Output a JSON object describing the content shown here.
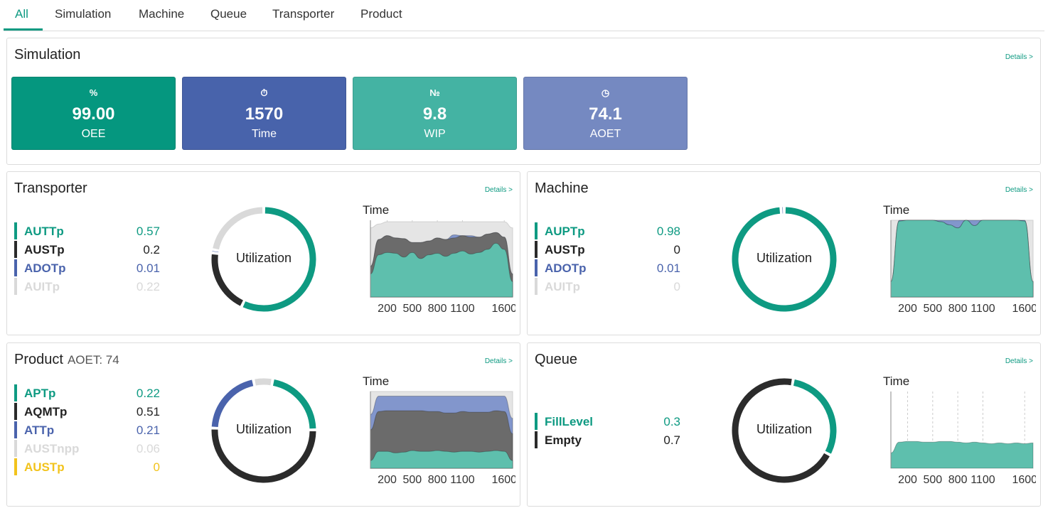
{
  "colors": {
    "teal": "#0e9a82",
    "dark": "#2b2b2b",
    "blue": "#4a63ac",
    "light": "#d9d9d9",
    "yellow": "#f2c31c",
    "area_teal": "#5ebfad",
    "area_dark": "#6b6b6b",
    "area_blue": "#8296cc",
    "area_light": "#e5e5e5"
  },
  "tabs": [
    {
      "label": "All",
      "active": true
    },
    {
      "label": "Simulation"
    },
    {
      "label": "Machine"
    },
    {
      "label": "Queue"
    },
    {
      "label": "Transporter"
    },
    {
      "label": "Product"
    }
  ],
  "simulation": {
    "title": "Simulation",
    "details": "Details >",
    "kpis": [
      {
        "icon": "percent-icon",
        "glyph": "%",
        "value": "99.00",
        "label": "OEE",
        "color": "#05977f"
      },
      {
        "icon": "stopwatch-icon",
        "glyph": "⏱",
        "value": "1570",
        "label": "Time",
        "color": "#4863ab"
      },
      {
        "icon": "numero-icon",
        "glyph": "№",
        "value": "9.8",
        "label": "WIP",
        "color": "#44b3a3"
      },
      {
        "icon": "clock-icon",
        "glyph": "◷",
        "value": "74.1",
        "label": "AOET",
        "color": "#7589c1"
      }
    ]
  },
  "transporter": {
    "title": "Transporter",
    "details": "Details >",
    "donut_label": "Utilization",
    "chart_title": "Time",
    "legend": [
      {
        "name": "AUTTp",
        "value": "0.57",
        "color": "#0e9a82"
      },
      {
        "name": "AUSTp",
        "value": "0.2",
        "color": "#2b2b2b"
      },
      {
        "name": "ADOTp",
        "value": "0.01",
        "color": "#4a63ac"
      },
      {
        "name": "AUITp",
        "value": "0.22",
        "color": "#d9d9d9"
      }
    ]
  },
  "machine": {
    "title": "Machine",
    "details": "Details >",
    "donut_label": "Utilization",
    "chart_title": "Time",
    "legend": [
      {
        "name": "AUPTp",
        "value": "0.98",
        "color": "#0e9a82"
      },
      {
        "name": "AUSTp",
        "value": "0",
        "color": "#2b2b2b"
      },
      {
        "name": "ADOTp",
        "value": "0.01",
        "color": "#4a63ac"
      },
      {
        "name": "AUITp",
        "value": "0",
        "color": "#d9d9d9"
      }
    ]
  },
  "product": {
    "title": "Product",
    "subtitle": "AOET: 74",
    "details": "Details >",
    "donut_label": "Utilization",
    "chart_title": "Time",
    "legend": [
      {
        "name": "APTp",
        "value": "0.22",
        "color": "#0e9a82"
      },
      {
        "name": "AQMTp",
        "value": "0.51",
        "color": "#2b2b2b"
      },
      {
        "name": "ATTp",
        "value": "0.21",
        "color": "#4a63ac"
      },
      {
        "name": "AUSTnpp",
        "value": "0.06",
        "color": "#d9d9d9"
      },
      {
        "name": "AUSTp",
        "value": "0",
        "color": "#f2c31c"
      }
    ]
  },
  "queue": {
    "title": "Queue",
    "details": "Details >",
    "donut_label": "Utilization",
    "chart_title": "Time",
    "legend": [
      {
        "name": "FillLevel",
        "value": "0.3",
        "color": "#0e9a82"
      },
      {
        "name": "Empty",
        "value": "0.7",
        "color": "#2b2b2b"
      }
    ]
  },
  "chart_data": [
    {
      "id": "transporter",
      "type": "area",
      "title": "Time",
      "x_ticks": [
        "200",
        "500",
        "800",
        "1100",
        "1600"
      ],
      "x": [
        0,
        100,
        200,
        300,
        400,
        500,
        600,
        700,
        800,
        900,
        1000,
        1100,
        1200,
        1300,
        1400,
        1500,
        1600,
        1700
      ],
      "ylim": [
        0,
        1
      ],
      "stacked": true,
      "series": [
        {
          "name": "AUTTp",
          "color": "#5ebfad",
          "values": [
            0.3,
            0.55,
            0.58,
            0.57,
            0.52,
            0.58,
            0.5,
            0.55,
            0.57,
            0.53,
            0.57,
            0.6,
            0.56,
            0.58,
            0.62,
            0.7,
            0.62,
            0.2
          ]
        },
        {
          "name": "AUSTp",
          "color": "#6b6b6b",
          "values": [
            0.1,
            0.2,
            0.22,
            0.2,
            0.24,
            0.13,
            0.21,
            0.18,
            0.2,
            0.22,
            0.2,
            0.2,
            0.22,
            0.2,
            0.2,
            0.14,
            0.16,
            0.1
          ]
        },
        {
          "name": "ADOTp",
          "color": "#8296cc",
          "values": [
            0,
            0,
            0,
            0,
            0,
            0,
            0,
            0,
            0,
            0,
            0.04,
            0,
            0.02,
            0,
            0,
            0,
            0,
            0
          ]
        },
        {
          "name": "AUITp",
          "color": "#e5e5e5",
          "values": [
            0.5,
            0.2,
            0.18,
            0.21,
            0.22,
            0.27,
            0.27,
            0.25,
            0.21,
            0.23,
            0.17,
            0.18,
            0.18,
            0.2,
            0.16,
            0.14,
            0.2,
            0.6
          ]
        }
      ]
    },
    {
      "id": "machine",
      "type": "area",
      "title": "Time",
      "x_ticks": [
        "200",
        "500",
        "800",
        "1100",
        "1600"
      ],
      "x": [
        0,
        100,
        200,
        300,
        400,
        500,
        600,
        700,
        800,
        900,
        1000,
        1100,
        1200,
        1300,
        1400,
        1500,
        1600,
        1700
      ],
      "ylim": [
        0,
        1
      ],
      "stacked": true,
      "series": [
        {
          "name": "AUPTp",
          "color": "#5ebfad",
          "values": [
            0.2,
            0.99,
            1,
            1,
            1,
            1,
            0.98,
            0.94,
            0.9,
            1,
            0.93,
            1,
            1,
            1,
            1,
            1,
            0.99,
            0.2
          ]
        },
        {
          "name": "AUSTp",
          "color": "#6b6b6b",
          "values": [
            0,
            0,
            0,
            0,
            0,
            0,
            0,
            0,
            0,
            0,
            0,
            0,
            0,
            0,
            0,
            0,
            0,
            0
          ]
        },
        {
          "name": "ADOTp",
          "color": "#8296cc",
          "values": [
            0,
            0.01,
            0,
            0,
            0,
            0,
            0.02,
            0.06,
            0.1,
            0,
            0.07,
            0,
            0,
            0,
            0,
            0,
            0.01,
            0
          ]
        },
        {
          "name": "AUITp",
          "color": "#e5e5e5",
          "values": [
            0.8,
            0,
            0,
            0,
            0,
            0,
            0,
            0,
            0,
            0,
            0,
            0,
            0,
            0,
            0,
            0,
            0,
            0.8
          ]
        }
      ]
    },
    {
      "id": "product",
      "type": "area",
      "title": "Time",
      "x_ticks": [
        "200",
        "500",
        "800",
        "1100",
        "1600"
      ],
      "x": [
        0,
        100,
        200,
        300,
        400,
        500,
        600,
        700,
        800,
        900,
        1000,
        1100,
        1200,
        1300,
        1400,
        1500,
        1600,
        1700
      ],
      "ylim": [
        0,
        1
      ],
      "stacked": true,
      "series": [
        {
          "name": "APTp",
          "color": "#5ebfad",
          "values": [
            0.1,
            0.22,
            0.22,
            0.2,
            0.21,
            0.23,
            0.22,
            0.22,
            0.23,
            0.22,
            0.21,
            0.22,
            0.22,
            0.21,
            0.22,
            0.23,
            0.22,
            0.1
          ]
        },
        {
          "name": "AQMTp",
          "color": "#6b6b6b",
          "values": [
            0.4,
            0.52,
            0.53,
            0.55,
            0.54,
            0.52,
            0.53,
            0.52,
            0.51,
            0.5,
            0.51,
            0.52,
            0.51,
            0.52,
            0.51,
            0.52,
            0.52,
            0.35
          ]
        },
        {
          "name": "ATTp",
          "color": "#8296cc",
          "values": [
            0.2,
            0.2,
            0.19,
            0.19,
            0.19,
            0.19,
            0.19,
            0.2,
            0.2,
            0.22,
            0.22,
            0.2,
            0.21,
            0.21,
            0.21,
            0.19,
            0.2,
            0.2
          ]
        },
        {
          "name": "AUSTnpp",
          "color": "#e5e5e5",
          "values": [
            0.3,
            0.06,
            0.06,
            0.06,
            0.06,
            0.06,
            0.06,
            0.06,
            0.06,
            0.06,
            0.06,
            0.06,
            0.06,
            0.06,
            0.06,
            0.06,
            0.06,
            0.35
          ]
        }
      ]
    },
    {
      "id": "queue",
      "type": "area",
      "title": "Time",
      "x_ticks": [
        "200",
        "500",
        "800",
        "1100",
        "1600"
      ],
      "x": [
        0,
        100,
        200,
        300,
        400,
        500,
        600,
        700,
        800,
        900,
        1000,
        1100,
        1200,
        1300,
        1400,
        1500,
        1600,
        1700
      ],
      "ylim": [
        0,
        1
      ],
      "stacked": false,
      "series": [
        {
          "name": "FillLevel",
          "color": "#5ebfad",
          "values": [
            0.2,
            0.34,
            0.35,
            0.35,
            0.34,
            0.34,
            0.35,
            0.35,
            0.34,
            0.33,
            0.34,
            0.33,
            0.32,
            0.33,
            0.32,
            0.33,
            0.32,
            0.33
          ]
        }
      ]
    }
  ]
}
